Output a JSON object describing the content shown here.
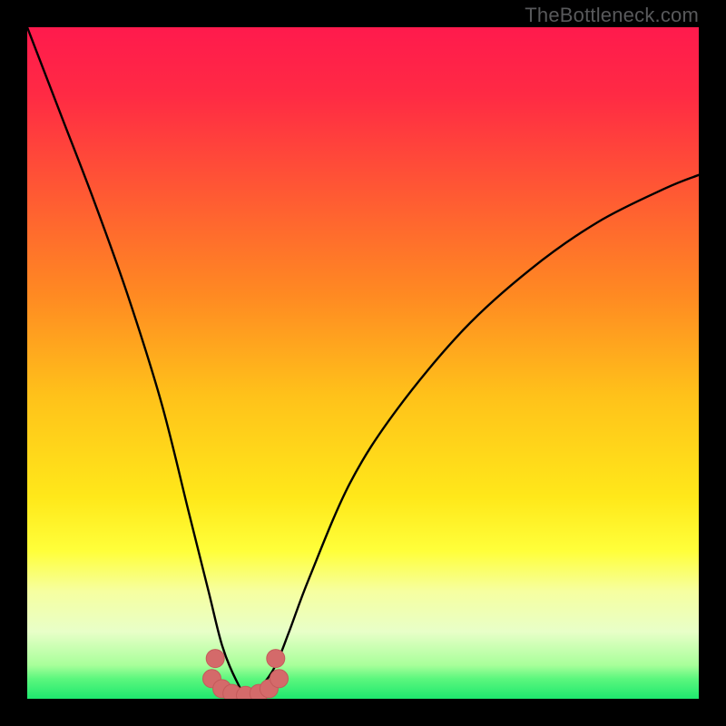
{
  "watermark": "TheBottleneck.com",
  "colors": {
    "black": "#000000",
    "curve": "#000000",
    "markers_fill": "#d46a6a",
    "markers_stroke": "#c45a5a",
    "gradient_stops": [
      {
        "offset": 0.0,
        "color": "#ff1a4d"
      },
      {
        "offset": 0.1,
        "color": "#ff2a44"
      },
      {
        "offset": 0.25,
        "color": "#ff5a33"
      },
      {
        "offset": 0.4,
        "color": "#ff8a22"
      },
      {
        "offset": 0.55,
        "color": "#ffc21a"
      },
      {
        "offset": 0.7,
        "color": "#ffe81a"
      },
      {
        "offset": 0.78,
        "color": "#ffff3a"
      },
      {
        "offset": 0.84,
        "color": "#f6ffa0"
      },
      {
        "offset": 0.9,
        "color": "#e8ffc8"
      },
      {
        "offset": 0.95,
        "color": "#a8ff9a"
      },
      {
        "offset": 0.97,
        "color": "#5cf77e"
      },
      {
        "offset": 1.0,
        "color": "#1ee86e"
      }
    ]
  },
  "chart_data": {
    "type": "line",
    "title": "",
    "xlabel": "",
    "ylabel": "",
    "xlim": [
      0,
      100
    ],
    "ylim": [
      0,
      100
    ],
    "grid": false,
    "legend": false,
    "note": "V-shaped bottleneck curve. y≈0 near x≈33; rises steeply on both sides. Values estimated from pixel positions on a 0–100 normalized plot area.",
    "series": [
      {
        "name": "bottleneck-curve",
        "x": [
          0,
          5,
          10,
          15,
          20,
          24,
          27,
          29,
          31,
          33,
          35,
          37,
          39,
          42,
          48,
          55,
          65,
          75,
          85,
          95,
          100
        ],
        "y": [
          100,
          87,
          74,
          60,
          44,
          28,
          16,
          8,
          3,
          0,
          2,
          5,
          10,
          18,
          32,
          43,
          55,
          64,
          71,
          76,
          78
        ]
      }
    ],
    "markers": {
      "name": "highlighted-points",
      "note": "cluster of points near curve minimum",
      "x": [
        27.5,
        29.0,
        30.5,
        32.5,
        34.5,
        36.0,
        37.5,
        28.0,
        37.0
      ],
      "y": [
        3.0,
        1.5,
        0.8,
        0.5,
        0.8,
        1.5,
        3.0,
        6.0,
        6.0
      ]
    }
  }
}
